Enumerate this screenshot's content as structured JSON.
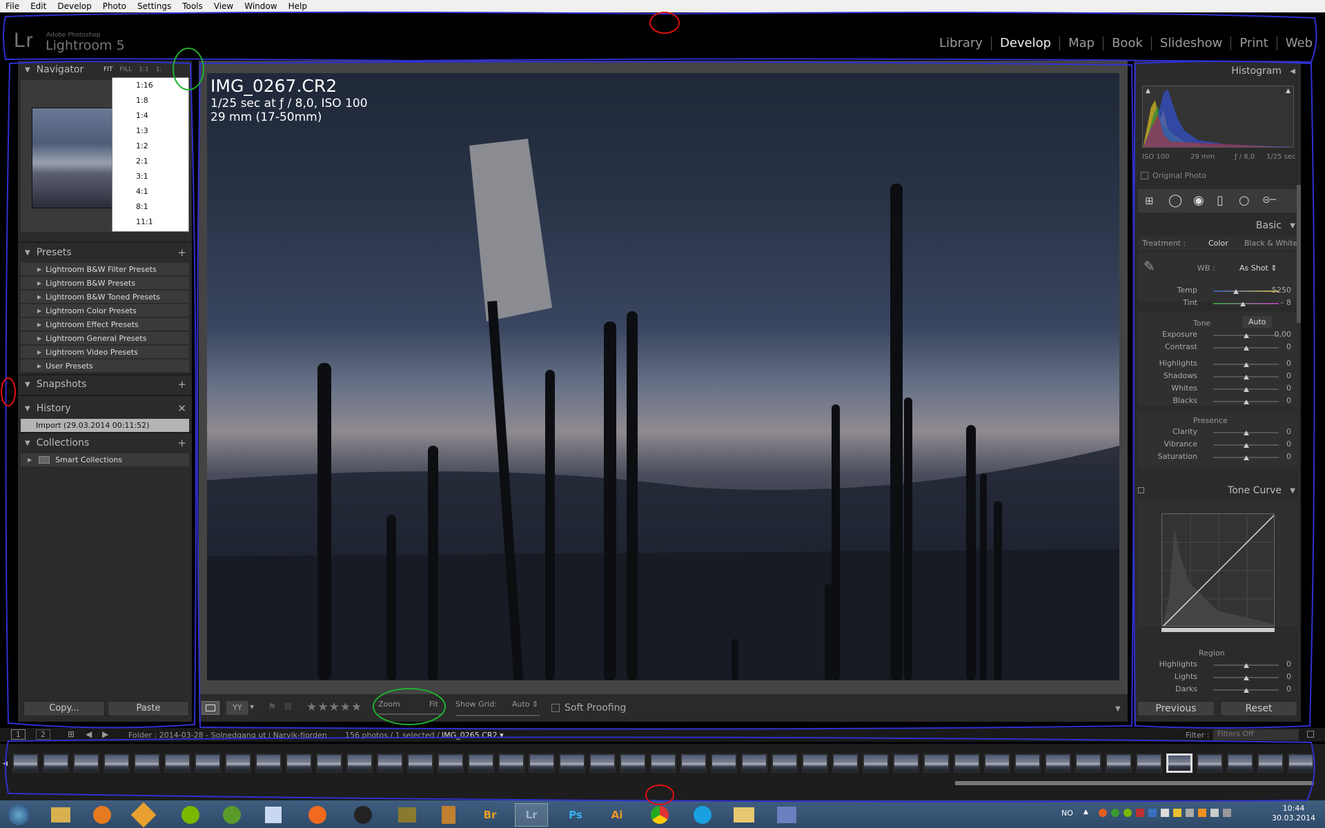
{
  "menu": [
    "File",
    "Edit",
    "Develop",
    "Photo",
    "Settings",
    "Tools",
    "View",
    "Window",
    "Help"
  ],
  "header": {
    "logo_mark": "Lr",
    "logo_adobe": "Adobe Photoshop",
    "logo_name": "Lightroom 5",
    "modules": [
      "Library",
      "Develop",
      "Map",
      "Book",
      "Slideshow",
      "Print",
      "Web"
    ],
    "active_module": "Develop"
  },
  "navigator": {
    "title": "Navigator",
    "options": [
      "FIT",
      "FILL",
      "1:1",
      "1:"
    ],
    "active_option": "FIT",
    "zoom_options": [
      "1:16",
      "1:8",
      "1:4",
      "1:3",
      "1:2",
      "2:1",
      "3:1",
      "4:1",
      "8:1",
      "11:1"
    ]
  },
  "presets": {
    "title": "Presets",
    "items": [
      "Lightroom B&W Filter Presets",
      "Lightroom B&W Presets",
      "Lightroom B&W Toned Presets",
      "Lightroom Color Presets",
      "Lightroom Effect Presets",
      "Lightroom General Presets",
      "Lightroom Video Presets",
      "User Presets"
    ]
  },
  "snapshots": {
    "title": "Snapshots"
  },
  "history": {
    "title": "History",
    "items": [
      "Import (29.03.2014 00:11:52)"
    ]
  },
  "collections": {
    "title": "Collections",
    "items": [
      "Smart Collections"
    ]
  },
  "left_buttons": {
    "copy": "Copy...",
    "paste": "Paste"
  },
  "photo_info": {
    "filename": "IMG_0267.CR2",
    "exposure": "1/25 sec at ƒ / 8,0, ISO 100",
    "lens": "29 mm (17-50mm)"
  },
  "toolbar": {
    "stars": "★★★★★",
    "zoom_label": "Zoom",
    "zoom_value": "Fit",
    "grid_label": "Show Grid:",
    "grid_value": "Auto ⇕",
    "soft_proofing": "Soft Proofing"
  },
  "histogram": {
    "title": "Histogram",
    "iso": "ISO 100",
    "focal": "29 mm",
    "aperture": "ƒ / 8,0",
    "shutter": "1/25 sec",
    "original_photo": "Original Photo"
  },
  "basic": {
    "title": "Basic",
    "treatment_label": "Treatment :",
    "treatment_color": "Color",
    "treatment_bw": "Black & White",
    "wb_label": "WB :",
    "wb_value": "As Shot ⇕",
    "tone_label": "Tone",
    "auto_label": "Auto",
    "presence_label": "Presence",
    "temp": {
      "label": "Temp",
      "value": "5250",
      "pos": 0.35
    },
    "tint": {
      "label": "Tint",
      "value": "– 8",
      "pos": 0.45
    },
    "sliders": [
      {
        "label": "Exposure",
        "value": "0,00",
        "pos": 0.5
      },
      {
        "label": "Contrast",
        "value": "0",
        "pos": 0.5
      },
      {
        "label": "Highlights",
        "value": "0",
        "pos": 0.5
      },
      {
        "label": "Shadows",
        "value": "0",
        "pos": 0.5
      },
      {
        "label": "Whites",
        "value": "0",
        "pos": 0.5
      },
      {
        "label": "Blacks",
        "value": "0",
        "pos": 0.5
      }
    ],
    "presence": [
      {
        "label": "Clarity",
        "value": "0",
        "pos": 0.5
      },
      {
        "label": "Vibrance",
        "value": "0",
        "pos": 0.5
      },
      {
        "label": "Saturation",
        "value": "0",
        "pos": 0.5
      }
    ]
  },
  "tone_curve": {
    "title": "Tone Curve",
    "region_label": "Region",
    "sliders": [
      {
        "label": "Highlights",
        "value": "0",
        "pos": 0.5
      },
      {
        "label": "Lights",
        "value": "0",
        "pos": 0.5
      },
      {
        "label": "Darks",
        "value": "0",
        "pos": 0.5
      }
    ]
  },
  "right_buttons": {
    "previous": "Previous",
    "reset": "Reset"
  },
  "filmbar": {
    "page1": "1",
    "page2": "2",
    "folder_text": "Folder : 2014-03-28 - Solnedgang ut i Narvik-fjorden",
    "count_text": "156 photos / 1 selected /",
    "selected_file": "IMG_0265.CR2 ▾",
    "filter_label": "Filter :",
    "filter_value": "Filters Off"
  },
  "taskbar": {
    "icons": [
      "Br",
      "Lr",
      "Ps",
      "Ai"
    ],
    "lang": "NO",
    "time": "10:44",
    "date": "30.03.2014"
  }
}
